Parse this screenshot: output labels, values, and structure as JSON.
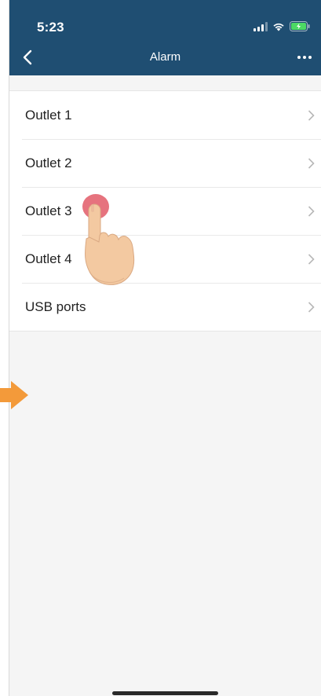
{
  "status_bar": {
    "time": "5:23",
    "icons": [
      "cellular-signal-icon",
      "wifi-icon",
      "battery-charging-icon"
    ]
  },
  "nav": {
    "title": "Alarm",
    "back_icon": "chevron-left-icon",
    "more_icon": "more-horizontal-icon"
  },
  "list": {
    "items": [
      {
        "label": "Outlet 1"
      },
      {
        "label": "Outlet 2"
      },
      {
        "label": "Outlet 3"
      },
      {
        "label": "Outlet 4"
      },
      {
        "label": "USB ports"
      }
    ]
  },
  "overlays": {
    "tap_indicator": "hand-tap-icon",
    "pointer": "orange-arrow-icon"
  },
  "colors": {
    "header": "#1f4e72",
    "background": "#f5f5f5",
    "tap_dot": "#e25b67",
    "arrow": "#f39a3a",
    "hand": "#f3c9a1"
  }
}
